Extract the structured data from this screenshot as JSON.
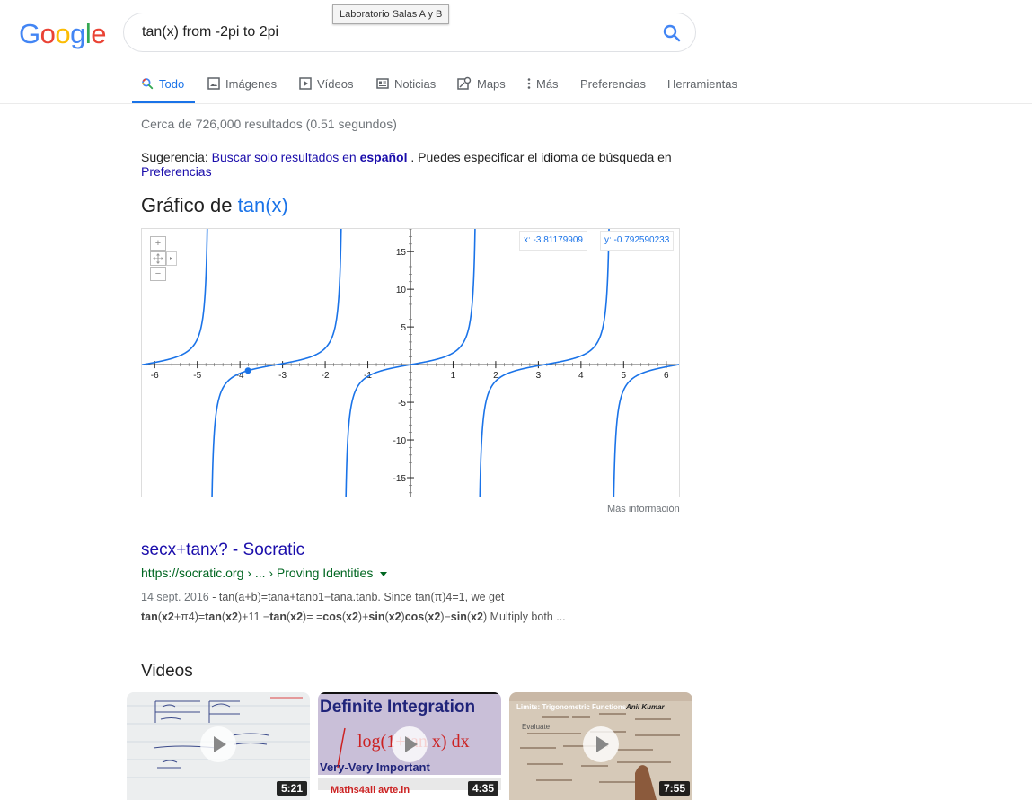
{
  "header": {
    "logo_letters": [
      {
        "ch": "G",
        "color": "#4285F4"
      },
      {
        "ch": "o",
        "color": "#EA4335"
      },
      {
        "ch": "o",
        "color": "#FBBC05"
      },
      {
        "ch": "g",
        "color": "#4285F4"
      },
      {
        "ch": "l",
        "color": "#34A853"
      },
      {
        "ch": "e",
        "color": "#EA4335"
      }
    ],
    "search_value": "tan(x) from -2pi to 2pi",
    "tooltip": "Laboratorio Salas A y B"
  },
  "tabs": [
    {
      "label": "Todo",
      "icon": "search-icon",
      "active": true
    },
    {
      "label": "Imágenes",
      "icon": "image-icon"
    },
    {
      "label": "Vídeos",
      "icon": "video-icon"
    },
    {
      "label": "Noticias",
      "icon": "news-icon"
    },
    {
      "label": "Maps",
      "icon": "map-icon"
    },
    {
      "label": "Más",
      "icon": "more-vert-icon"
    },
    {
      "label": "Preferencias"
    },
    {
      "label": "Herramientas"
    }
  ],
  "stats": "Cerca de 726,000 resultados (0.51 segundos)",
  "suggestion": {
    "prefix": "Sugerencia:",
    "link_text": "Buscar solo resultados en",
    "link_bold": "español",
    "suffix": ". Puedes especificar el idioma de búsqueda en",
    "pref_link": "Preferencias"
  },
  "graph": {
    "title_prefix": "Gráfico de",
    "function": "tan(x)",
    "x_readout": "x: -3.81179909",
    "y_readout": "y: -0.792590233",
    "more_info": "Más información",
    "zoom_in": "+",
    "zoom_out": "−"
  },
  "chart_data": {
    "type": "line",
    "function": "tan(x)",
    "xlim": [
      -6.3,
      6.3
    ],
    "ylim": [
      -17.5,
      18
    ],
    "x_ticks": [
      -6,
      -5,
      -4,
      -3,
      -2,
      -1,
      1,
      2,
      3,
      4,
      5,
      6
    ],
    "y_ticks": [
      15,
      10,
      5,
      -5,
      -10,
      -15
    ],
    "highlight_point": {
      "x": -3.81179909,
      "y": -0.792590233
    },
    "line_color": "#1a73e8"
  },
  "result": {
    "title": "secx+tanx? - Socratic",
    "url": "https://socratic.org › ... › Proving Identities",
    "date": "14 sept. 2016",
    "snippet_line1": " - tan(a+b)=tana+tanb1−tana.tanb. Since tan(π)4=1, we get",
    "snippet_line2_parts": [
      {
        "t": "tan",
        "b": true
      },
      {
        "t": "(",
        "b": false
      },
      {
        "t": "x2",
        "b": true
      },
      {
        "t": "+π4)=",
        "b": false
      },
      {
        "t": "tan",
        "b": true
      },
      {
        "t": "(",
        "b": false
      },
      {
        "t": "x2",
        "b": true
      },
      {
        "t": ")+11 −",
        "b": false
      },
      {
        "t": "tan",
        "b": true
      },
      {
        "t": "(",
        "b": false
      },
      {
        "t": "x2",
        "b": true
      },
      {
        "t": ")= =",
        "b": false
      },
      {
        "t": "cos",
        "b": true
      },
      {
        "t": "(",
        "b": false
      },
      {
        "t": "x2",
        "b": true
      },
      {
        "t": ")+",
        "b": false
      },
      {
        "t": "sin",
        "b": true
      },
      {
        "t": "(",
        "b": false
      },
      {
        "t": "x2",
        "b": true
      },
      {
        "t": ")",
        "b": false
      },
      {
        "t": "cos",
        "b": true
      },
      {
        "t": "(",
        "b": false
      },
      {
        "t": "x2",
        "b": true
      },
      {
        "t": ")−",
        "b": false
      },
      {
        "t": "sin",
        "b": true
      },
      {
        "t": "(",
        "b": false
      },
      {
        "t": "x2",
        "b": true
      },
      {
        "t": ") Multiply both ...",
        "b": false
      }
    ]
  },
  "videos": {
    "heading": "Videos",
    "items": [
      {
        "duration": "5:21",
        "thumb_bg": "#eceeef"
      },
      {
        "duration": "4:35",
        "thumb_bg": "#c9bfd8",
        "title_text": "Definite Integration",
        "integral_text": "log(1+tan x) dx",
        "bottom_text": "Very-Very Important",
        "footer": "Maths4all   avte.in"
      },
      {
        "duration": "7:55",
        "thumb_bg": "#c9b8a6",
        "title_text": "Limits: Trigonometric Functions",
        "author": "Anil Kumar",
        "evaluate": "Evaluate"
      }
    ]
  }
}
